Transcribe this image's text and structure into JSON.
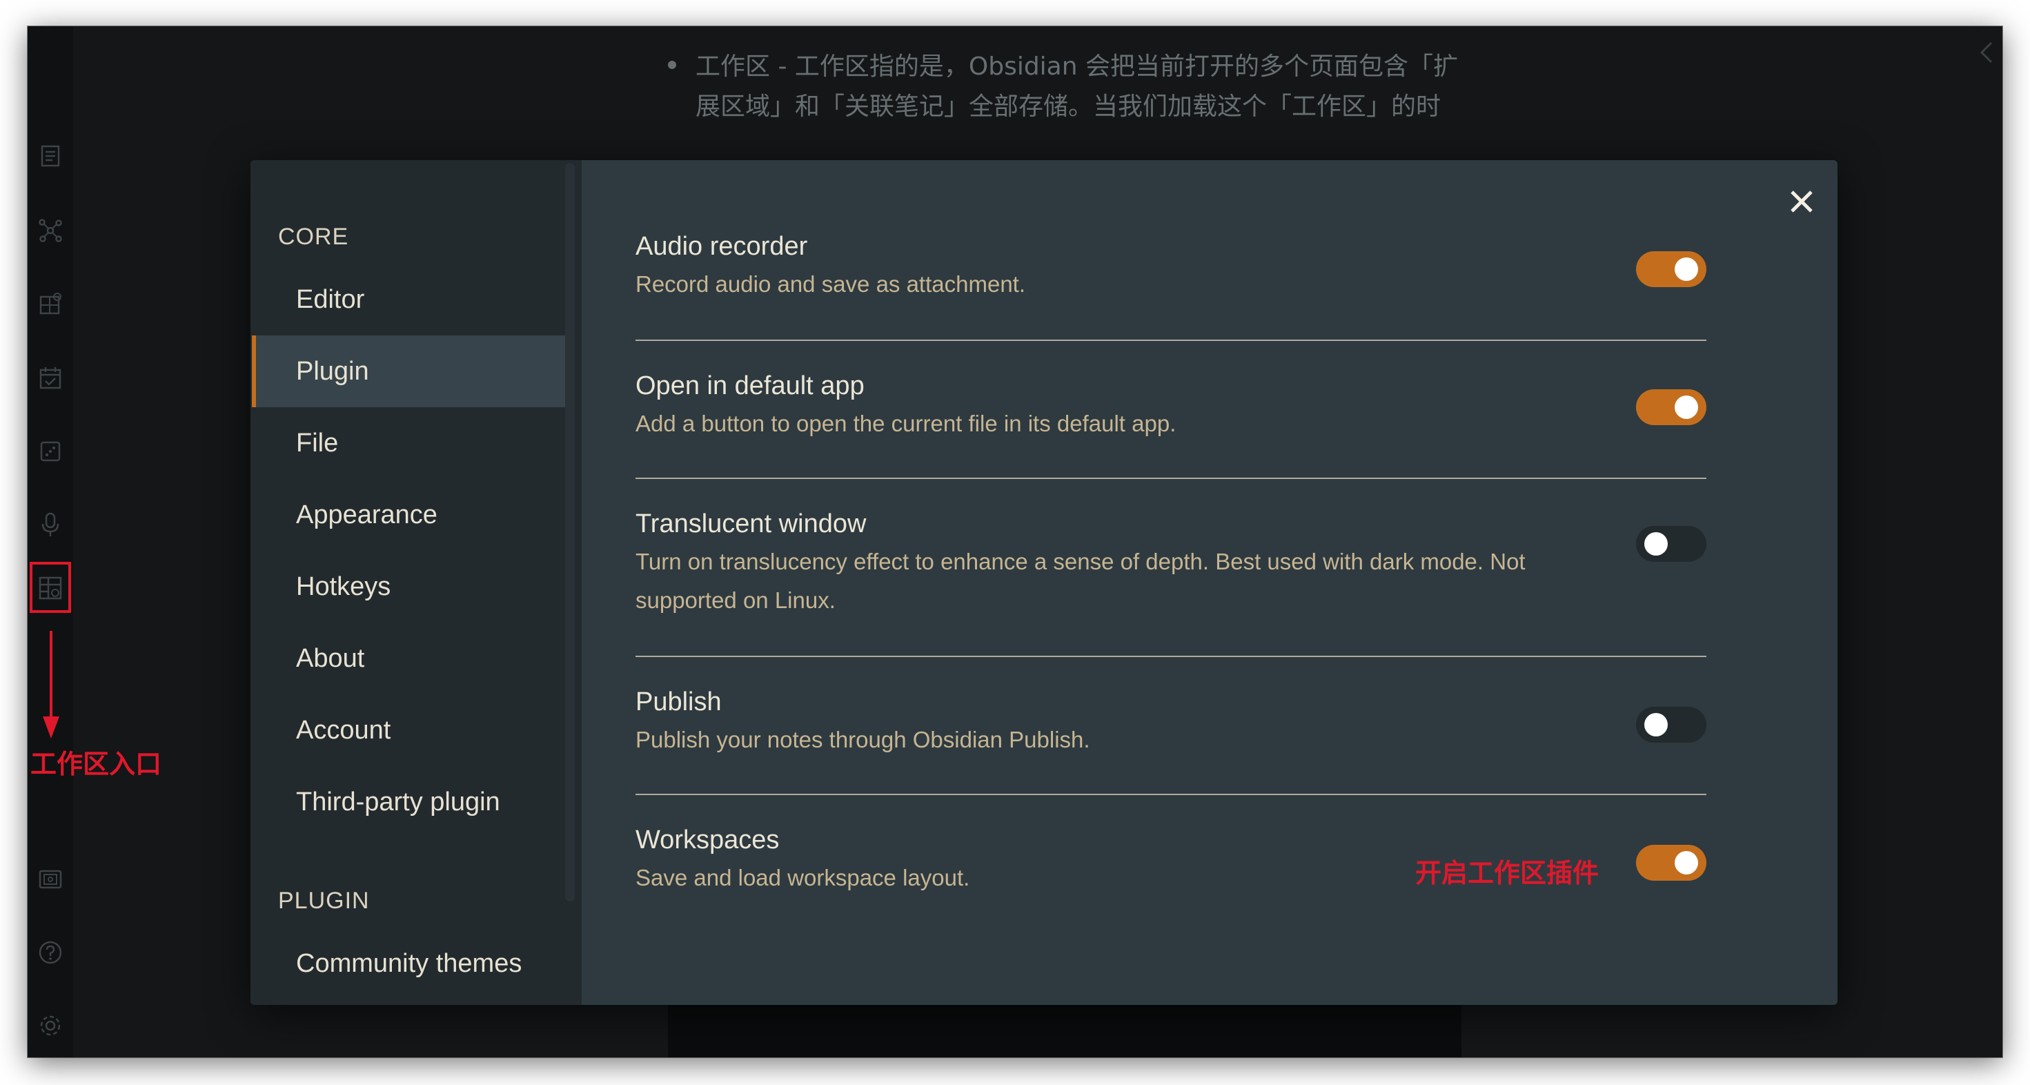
{
  "background_document": {
    "line1": "工作区 - 工作区指的是，Obsidian 会把当前打开的多个页面包含「扩",
    "line2": "展区域」和「关联笔记」全部存储。当我们加载这个「工作区」的时"
  },
  "ribbon": {
    "icons": [
      "outline-icon",
      "graph-icon",
      "puzzle-icon",
      "calendar-check-icon",
      "dice-icon",
      "microphone-icon",
      "workspace-layout-icon",
      "vault-icon",
      "help-icon",
      "gear-icon"
    ],
    "annotation": "工作区入口"
  },
  "settings": {
    "close_symbol": "✕",
    "sidebar": {
      "core_heading": "CORE",
      "plugin_heading": "PLUGIN",
      "core_items": [
        "Editor",
        "Plugin",
        "File",
        "Appearance",
        "Hotkeys",
        "About",
        "Account",
        "Third-party plugin"
      ],
      "plugin_items": [
        "Community themes"
      ],
      "active_item": "Plugin"
    },
    "plugins": [
      {
        "name": "Audio recorder",
        "desc": "Record audio and save as attachment.",
        "enabled": true
      },
      {
        "name": "Open in default app",
        "desc": "Add a button to open the current file in its default app.",
        "enabled": true
      },
      {
        "name": "Translucent window",
        "desc": "Turn on translucency effect to enhance a sense of depth. Best used with dark mode. Not supported on Linux.",
        "enabled": false
      },
      {
        "name": "Publish",
        "desc": "Publish your notes through Obsidian Publish.",
        "enabled": false
      },
      {
        "name": "Workspaces",
        "desc": "Save and load workspace layout.",
        "enabled": true
      }
    ],
    "enable_annotation": "开启工作区插件"
  },
  "colors": {
    "accent": "#c46e1d",
    "annotation_red": "#e0182b",
    "modal_bg": "#2e3a40",
    "sidebar_bg": "#222a2e"
  }
}
